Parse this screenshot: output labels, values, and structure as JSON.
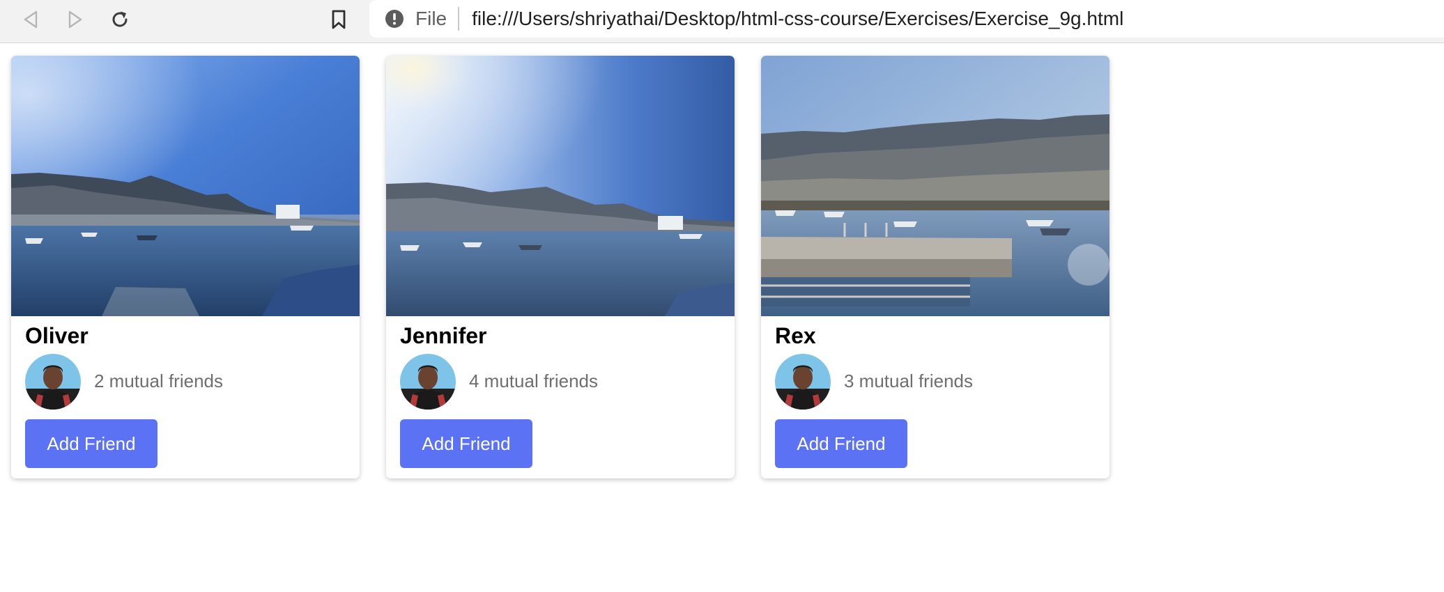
{
  "browser": {
    "scheme_label": "File",
    "url": "file:///Users/shriyathai/Desktop/html-css-course/Exercises/Exercise_9g.html",
    "icons": [
      "back-icon",
      "forward-icon",
      "reload-icon",
      "bookmark-icon",
      "info-icon"
    ]
  },
  "cards": [
    {
      "name": "Oliver",
      "mutual": "2 mutual friends",
      "button": "Add Friend"
    },
    {
      "name": "Jennifer",
      "mutual": "4 mutual friends",
      "button": "Add Friend"
    },
    {
      "name": "Rex",
      "mutual": "3 mutual friends",
      "button": "Add Friend"
    }
  ],
  "colors": {
    "button": "#5b72f5",
    "toolbar": "#f2f2f2",
    "muted_text": "#6e6e6e"
  }
}
